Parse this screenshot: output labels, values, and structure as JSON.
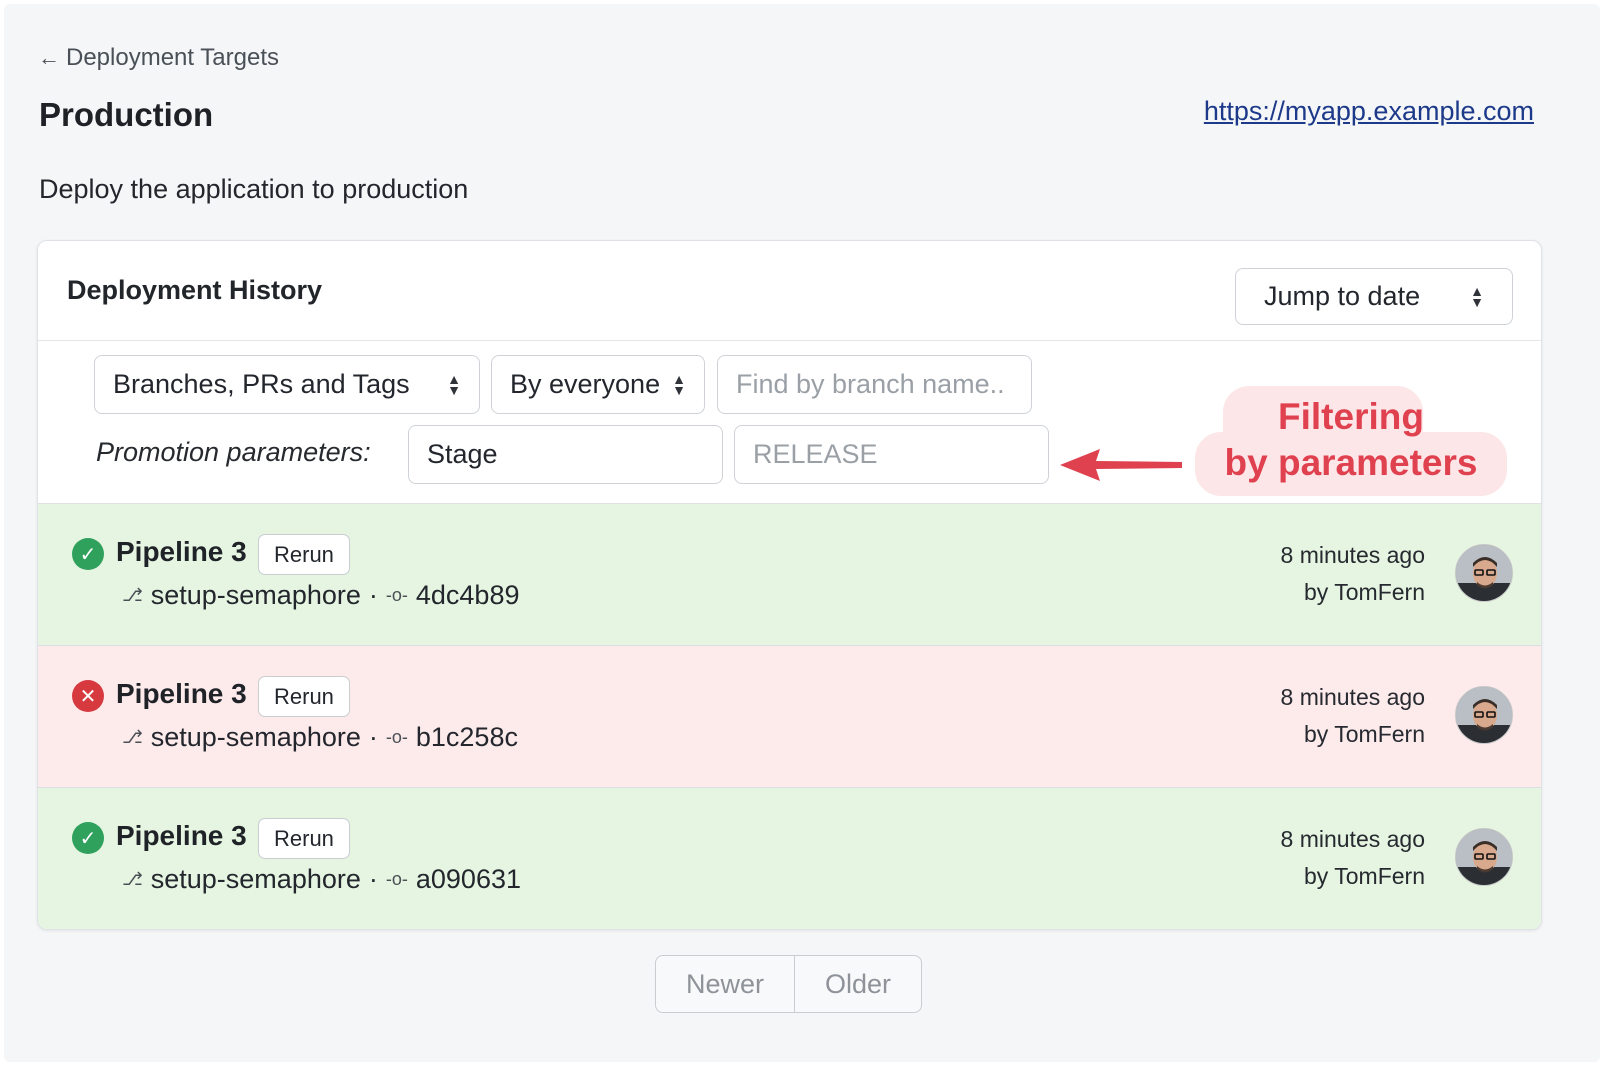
{
  "nav": {
    "back_label": "Deployment Targets"
  },
  "target": {
    "title": "Production",
    "url": "https://myapp.example.com",
    "description": "Deploy the application to production"
  },
  "history": {
    "title": "Deployment History",
    "jump_label": "Jump to date",
    "filters": {
      "type_select": "Branches, PRs and Tags",
      "author_select": "By everyone",
      "branch_placeholder": "Find by branch name..",
      "promo_label": "Promotion parameters:",
      "param1_value": "Stage",
      "param2_placeholder": "RELEASE"
    },
    "annotation": {
      "line1": "Filtering",
      "line2": "by parameters"
    },
    "rows": [
      {
        "status": "passed",
        "pipeline": "Pipeline 3",
        "rerun": "Rerun",
        "branch": "setup-semaphore",
        "commit": "4dc4b89",
        "time": "8 minutes ago",
        "by": "by TomFern"
      },
      {
        "status": "failed",
        "pipeline": "Pipeline 3",
        "rerun": "Rerun",
        "branch": "setup-semaphore",
        "commit": "b1c258c",
        "time": "8 minutes ago",
        "by": "by TomFern"
      },
      {
        "status": "passed",
        "pipeline": "Pipeline 3",
        "rerun": "Rerun",
        "branch": "setup-semaphore",
        "commit": "a090631",
        "time": "8 minutes ago",
        "by": "by TomFern"
      }
    ]
  },
  "pager": {
    "newer": "Newer",
    "older": "Older"
  },
  "colors": {
    "passed": "#2fa15c",
    "failed": "#d63a3f",
    "annotation": "#e0414f",
    "link": "#1d3a8a"
  }
}
